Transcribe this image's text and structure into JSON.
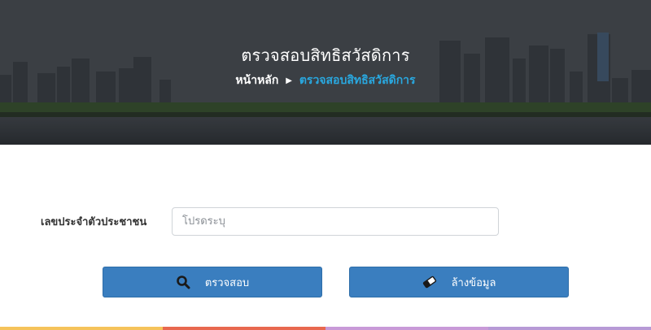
{
  "hero": {
    "title": "ตรวจสอบสิทธิสวัสดิการ",
    "breadcrumb": {
      "home": "หน้าหลัก",
      "separator": "▶",
      "current": "ตรวจสอบสิทธิสวัสดิการ"
    }
  },
  "form": {
    "id_label": "เลขประจำตัวประชาชน",
    "id_placeholder": "โปรดระบุ",
    "id_value": ""
  },
  "buttons": {
    "check_label": "ตรวจสอบ",
    "check_icon": "search-icon",
    "clear_label": "ล้างข้อมูล",
    "clear_icon": "eraser-icon"
  },
  "colors": {
    "button": "#3a7ebf",
    "breadcrumb_current": "#29a8e0",
    "bottom_bar": [
      "#f5c35a",
      "#e8684f",
      "#c89ad8",
      "#b79ad6"
    ]
  }
}
